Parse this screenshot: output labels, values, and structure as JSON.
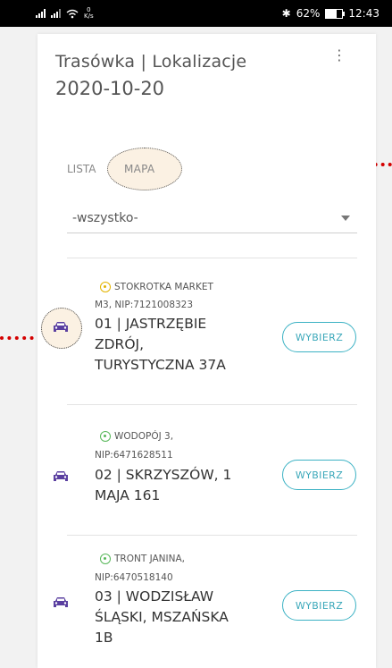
{
  "statusbar": {
    "netspeed_value": "0",
    "netspeed_unit": "K/s",
    "bluetooth": "✱",
    "battery": "62%",
    "time": "12:43"
  },
  "header": {
    "title": "Trasówka | Lokalizacje",
    "date": "2020-10-20",
    "menu_icon": "⋮"
  },
  "tabs": [
    {
      "label": "LISTA"
    },
    {
      "label": "MAPA"
    }
  ],
  "filter": {
    "value": "-wszystko-"
  },
  "items": [
    {
      "name_l1": "STOKROTKA MARKET",
      "name_l2": "M3, NIP:7121008323",
      "addr_l1": "01 | JASTRZĘBIE",
      "addr_l2": "ZDRÓJ,",
      "addr_l3": "TURYSTYCZNA 37A",
      "button": "WYBIERZ",
      "pin_color": "#e3b400"
    },
    {
      "name_l1": "WODOPÓJ 3,",
      "name_l2": "NIP:6471628511",
      "addr_l1": "02 | SKRZYSZÓW, 1",
      "addr_l2": "MAJA 161",
      "addr_l3": "",
      "button": "WYBIERZ",
      "pin_color": "#58b85a"
    },
    {
      "name_l1": "TRONT JANINA,",
      "name_l2": "NIP:6470518140",
      "addr_l1": "03 | WODZISŁAW",
      "addr_l2": "ŚLĄSKI, MSZAŃSKA",
      "addr_l3": "1B",
      "button": "WYBIERZ",
      "pin_color": "#58b85a"
    }
  ],
  "colors": {
    "accent": "#3cb2c4",
    "car": "#5a3fa0",
    "highlight": "#d40000"
  }
}
